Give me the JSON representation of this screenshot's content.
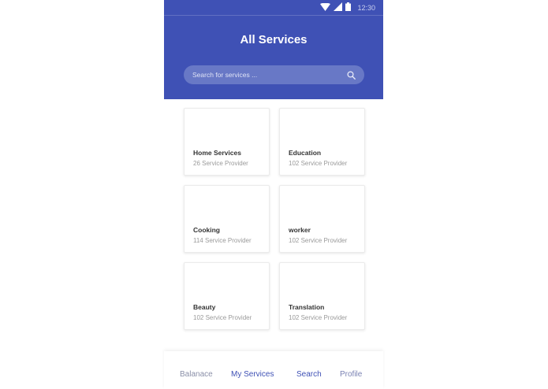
{
  "status_bar": {
    "time": "12:30",
    "icons": [
      "wifi-icon",
      "signal-icon",
      "battery-icon"
    ]
  },
  "header": {
    "title": "All Services",
    "background": "#3f51b5"
  },
  "search": {
    "placeholder": "Search for services ...",
    "value": "",
    "icon": "search-icon"
  },
  "services": [
    {
      "name": "Home Services",
      "providers": "26 Service Provider"
    },
    {
      "name": "Education",
      "providers": "102 Service Provider"
    },
    {
      "name": "Cooking",
      "providers": "114 Service Provider"
    },
    {
      "name": "worker",
      "providers": "102 Service Provider"
    },
    {
      "name": "Beauty",
      "providers": "102 Service Provider"
    },
    {
      "name": "Translation",
      "providers": "102 Service Provider"
    }
  ],
  "bottom_nav": {
    "balance": "Balanace",
    "my_services": "My Services",
    "search": "Search",
    "profile": "Profile"
  },
  "colors": {
    "primary": "#3f51b5",
    "nav_active": "#3f51b5",
    "nav_inactive": "#8a8fa8"
  }
}
